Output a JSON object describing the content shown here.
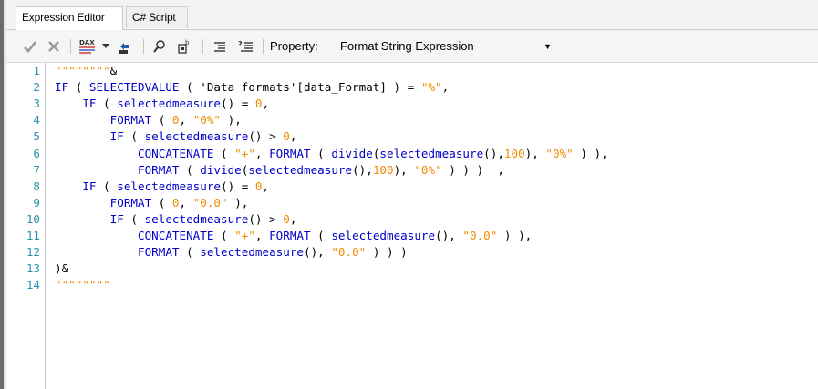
{
  "tabs": [
    {
      "label": "Expression Editor",
      "active": true
    },
    {
      "label": "C# Script",
      "active": false
    }
  ],
  "toolbar": {
    "icons": [
      "check-icon",
      "cancel-icon",
      "dax-format-icon",
      "deploy-icon",
      "search-icon",
      "find-replace-icon",
      "comment-icon",
      "uncomment-icon"
    ],
    "property_label": "Property:",
    "property_value": "Format String Expression"
  },
  "editor": {
    "lines": [
      {
        "num": "1",
        "tokens": [
          {
            "t": "str",
            "v": "\"\"\"\"\"\"\"\""
          },
          {
            "t": "txt",
            "v": "&"
          }
        ]
      },
      {
        "num": "2",
        "tokens": [
          {
            "t": "kw",
            "v": "IF"
          },
          {
            "t": "txt",
            "v": " ( "
          },
          {
            "t": "kw",
            "v": "SELECTEDVALUE"
          },
          {
            "t": "txt",
            "v": " ( 'Data formats'[data_Format] ) = "
          },
          {
            "t": "str",
            "v": "\"%\""
          },
          {
            "t": "txt",
            "v": ","
          }
        ]
      },
      {
        "num": "3",
        "tokens": [
          {
            "t": "txt",
            "v": "    "
          },
          {
            "t": "kw",
            "v": "IF"
          },
          {
            "t": "txt",
            "v": " ( "
          },
          {
            "t": "kw",
            "v": "selectedmeasure"
          },
          {
            "t": "txt",
            "v": "() = "
          },
          {
            "t": "num",
            "v": "0"
          },
          {
            "t": "txt",
            "v": ","
          }
        ]
      },
      {
        "num": "4",
        "tokens": [
          {
            "t": "txt",
            "v": "        "
          },
          {
            "t": "kw",
            "v": "FORMAT"
          },
          {
            "t": "txt",
            "v": " ( "
          },
          {
            "t": "num",
            "v": "0"
          },
          {
            "t": "txt",
            "v": ", "
          },
          {
            "t": "str",
            "v": "\"0%\""
          },
          {
            "t": "txt",
            "v": " ),"
          }
        ]
      },
      {
        "num": "5",
        "tokens": [
          {
            "t": "txt",
            "v": "        "
          },
          {
            "t": "kw",
            "v": "IF"
          },
          {
            "t": "txt",
            "v": " ( "
          },
          {
            "t": "kw",
            "v": "selectedmeasure"
          },
          {
            "t": "txt",
            "v": "() > "
          },
          {
            "t": "num",
            "v": "0"
          },
          {
            "t": "txt",
            "v": ","
          }
        ]
      },
      {
        "num": "6",
        "tokens": [
          {
            "t": "txt",
            "v": "            "
          },
          {
            "t": "kw",
            "v": "CONCATENATE"
          },
          {
            "t": "txt",
            "v": " ( "
          },
          {
            "t": "str",
            "v": "\"+\""
          },
          {
            "t": "txt",
            "v": ", "
          },
          {
            "t": "kw",
            "v": "FORMAT"
          },
          {
            "t": "txt",
            "v": " ( "
          },
          {
            "t": "kw",
            "v": "divide"
          },
          {
            "t": "txt",
            "v": "("
          },
          {
            "t": "kw",
            "v": "selectedmeasure"
          },
          {
            "t": "txt",
            "v": "(),"
          },
          {
            "t": "num",
            "v": "100"
          },
          {
            "t": "txt",
            "v": "), "
          },
          {
            "t": "str",
            "v": "\"0%\""
          },
          {
            "t": "txt",
            "v": " ) ),"
          }
        ]
      },
      {
        "num": "7",
        "tokens": [
          {
            "t": "txt",
            "v": "            "
          },
          {
            "t": "kw",
            "v": "FORMAT"
          },
          {
            "t": "txt",
            "v": " ( "
          },
          {
            "t": "kw",
            "v": "divide"
          },
          {
            "t": "txt",
            "v": "("
          },
          {
            "t": "kw",
            "v": "selectedmeasure"
          },
          {
            "t": "txt",
            "v": "(),"
          },
          {
            "t": "num",
            "v": "100"
          },
          {
            "t": "txt",
            "v": "), "
          },
          {
            "t": "str",
            "v": "\"0%\""
          },
          {
            "t": "txt",
            "v": " ) ) )  ,"
          }
        ]
      },
      {
        "num": "8",
        "tokens": [
          {
            "t": "txt",
            "v": "    "
          },
          {
            "t": "kw",
            "v": "IF"
          },
          {
            "t": "txt",
            "v": " ( "
          },
          {
            "t": "kw",
            "v": "selectedmeasure"
          },
          {
            "t": "txt",
            "v": "() = "
          },
          {
            "t": "num",
            "v": "0"
          },
          {
            "t": "txt",
            "v": ","
          }
        ]
      },
      {
        "num": "9",
        "tokens": [
          {
            "t": "txt",
            "v": "        "
          },
          {
            "t": "kw",
            "v": "FORMAT"
          },
          {
            "t": "txt",
            "v": " ( "
          },
          {
            "t": "num",
            "v": "0"
          },
          {
            "t": "txt",
            "v": ", "
          },
          {
            "t": "str",
            "v": "\"0.0\""
          },
          {
            "t": "txt",
            "v": " ),"
          }
        ]
      },
      {
        "num": "10",
        "tokens": [
          {
            "t": "txt",
            "v": "        "
          },
          {
            "t": "kw",
            "v": "IF"
          },
          {
            "t": "txt",
            "v": " ( "
          },
          {
            "t": "kw",
            "v": "selectedmeasure"
          },
          {
            "t": "txt",
            "v": "() > "
          },
          {
            "t": "num",
            "v": "0"
          },
          {
            "t": "txt",
            "v": ","
          }
        ]
      },
      {
        "num": "11",
        "tokens": [
          {
            "t": "txt",
            "v": "            "
          },
          {
            "t": "kw",
            "v": "CONCATENATE"
          },
          {
            "t": "txt",
            "v": " ( "
          },
          {
            "t": "str",
            "v": "\"+\""
          },
          {
            "t": "txt",
            "v": ", "
          },
          {
            "t": "kw",
            "v": "FORMAT"
          },
          {
            "t": "txt",
            "v": " ( "
          },
          {
            "t": "kw",
            "v": "selectedmeasure"
          },
          {
            "t": "txt",
            "v": "(), "
          },
          {
            "t": "str",
            "v": "\"0.0\""
          },
          {
            "t": "txt",
            "v": " ) ),"
          }
        ]
      },
      {
        "num": "12",
        "tokens": [
          {
            "t": "txt",
            "v": "            "
          },
          {
            "t": "kw",
            "v": "FORMAT"
          },
          {
            "t": "txt",
            "v": " ( "
          },
          {
            "t": "kw",
            "v": "selectedmeasure"
          },
          {
            "t": "txt",
            "v": "(), "
          },
          {
            "t": "str",
            "v": "\"0.0\""
          },
          {
            "t": "txt",
            "v": " ) ) )"
          }
        ]
      },
      {
        "num": "13",
        "tokens": [
          {
            "t": "txt",
            "v": ")&"
          }
        ]
      },
      {
        "num": "14",
        "tokens": [
          {
            "t": "str",
            "v": "\"\"\"\"\"\"\"\""
          }
        ]
      }
    ]
  },
  "colors": {
    "keyword": "#0000cc",
    "string": "#f28c00",
    "line_number": "#2b91af"
  }
}
